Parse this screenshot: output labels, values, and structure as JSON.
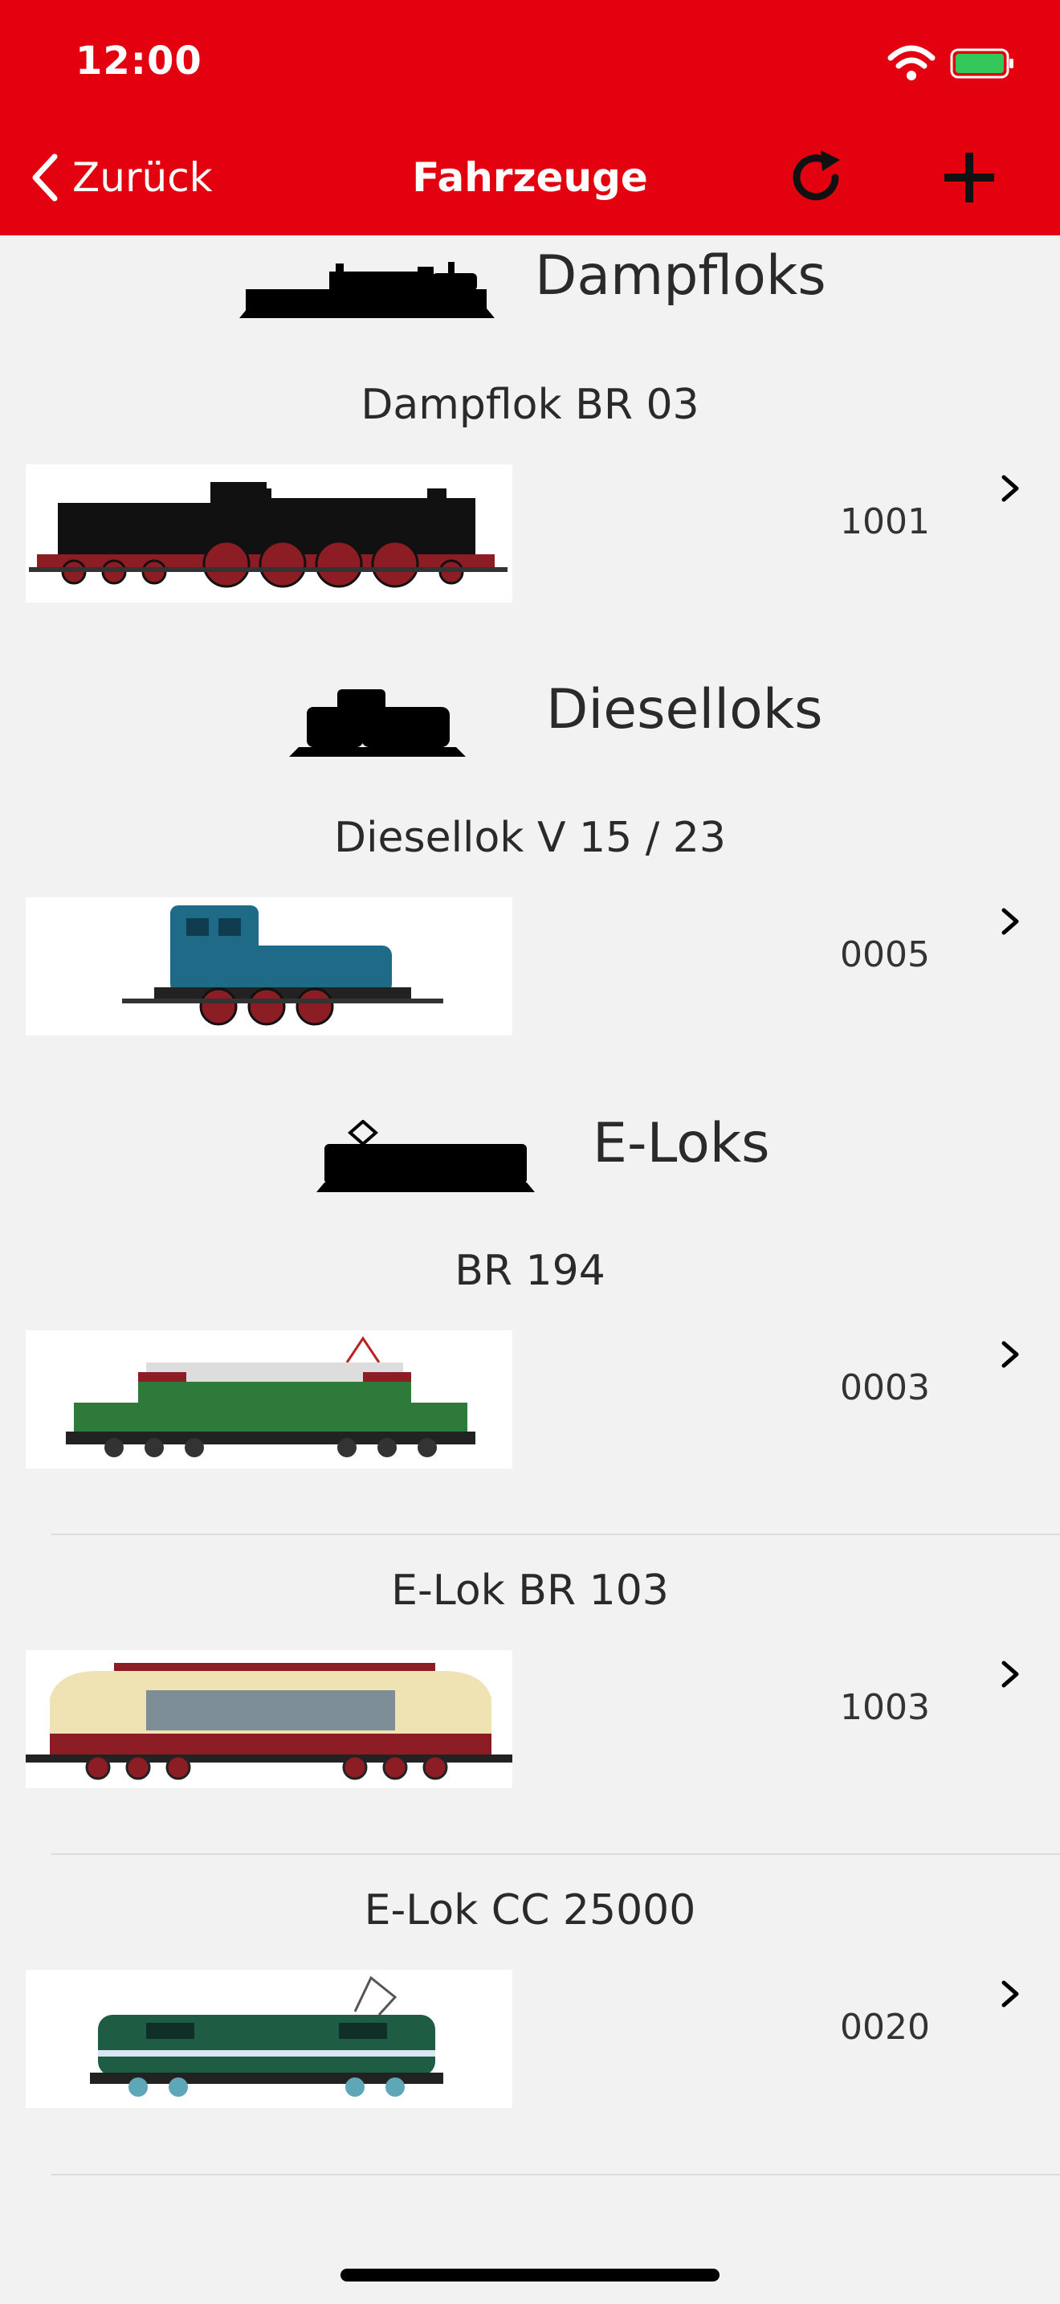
{
  "status": {
    "time": "12:00"
  },
  "nav": {
    "back_label": "Zurück",
    "title": "Fahrzeuge"
  },
  "sections": [
    {
      "title": "Dampfloks",
      "icon": "steam-locomotive-silhouette-icon",
      "items": [
        {
          "name": "Dampflok BR 03",
          "address": "1001"
        }
      ]
    },
    {
      "title": "Dieselloks",
      "icon": "diesel-locomotive-silhouette-icon",
      "items": [
        {
          "name": "Diesellok V 15 / 23",
          "address": "0005"
        }
      ]
    },
    {
      "title": "E-Loks",
      "icon": "electric-locomotive-silhouette-icon",
      "items": [
        {
          "name": "BR 194",
          "address": "0003"
        },
        {
          "name": "E-Lok BR 103",
          "address": "1003"
        },
        {
          "name": "E-Lok CC 25000",
          "address": "0020"
        }
      ]
    }
  ],
  "colors": {
    "accent": "#e3000f",
    "background": "#f2f2f2"
  }
}
